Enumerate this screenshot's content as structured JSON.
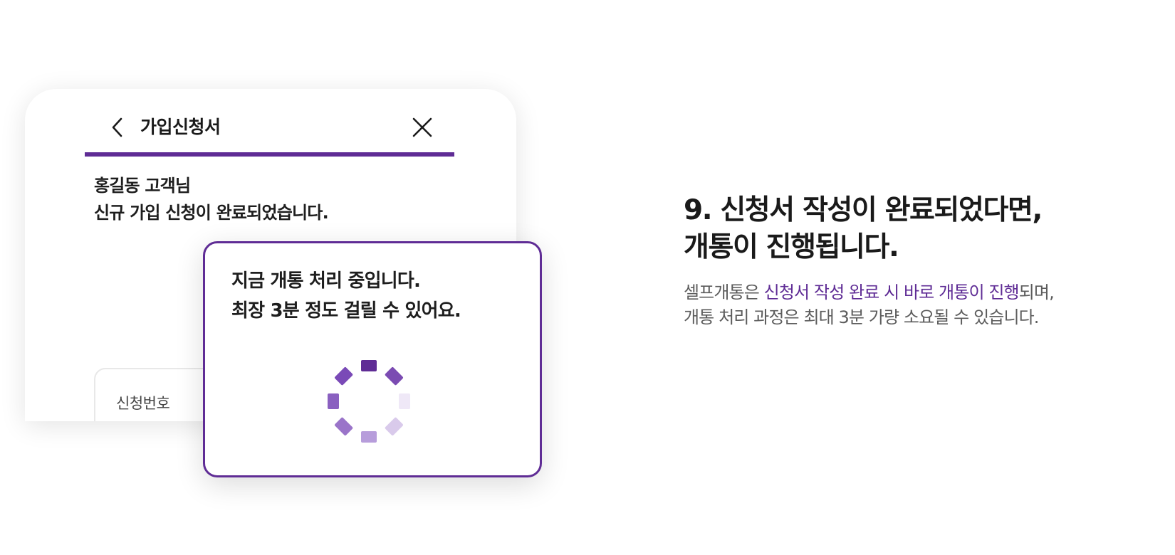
{
  "form": {
    "title": "가입신청서",
    "back_icon": "chevron-left-icon",
    "close_icon": "close-icon",
    "progress": 1.0,
    "greeting_line1": "홍길동 고객님",
    "greeting_line2": "신규 가입 신청이 완료되었습니다.",
    "application_number_label": "신청번호"
  },
  "processing": {
    "line1": "지금 개통 처리 중입니다.",
    "line2": "최장 3분 정도 걸릴 수 있어요.",
    "spinner_icon": "loading-spinner-icon"
  },
  "step": {
    "heading_line1": "9. 신청서 작성이 완료되었다면,",
    "heading_line2": "개통이 진행됩니다.",
    "desc_part1": "셀프개통은 ",
    "desc_accent": "신청서 작성 완료 시 바로 개통이 진행",
    "desc_part2": "되며,",
    "desc_line2": "개통 처리 과정은 최대 3분 가량 소요될 수 있습니다."
  },
  "colors": {
    "accent": "#5f2c95",
    "text": "#1a1a1a",
    "muted": "#5c5c5c"
  }
}
